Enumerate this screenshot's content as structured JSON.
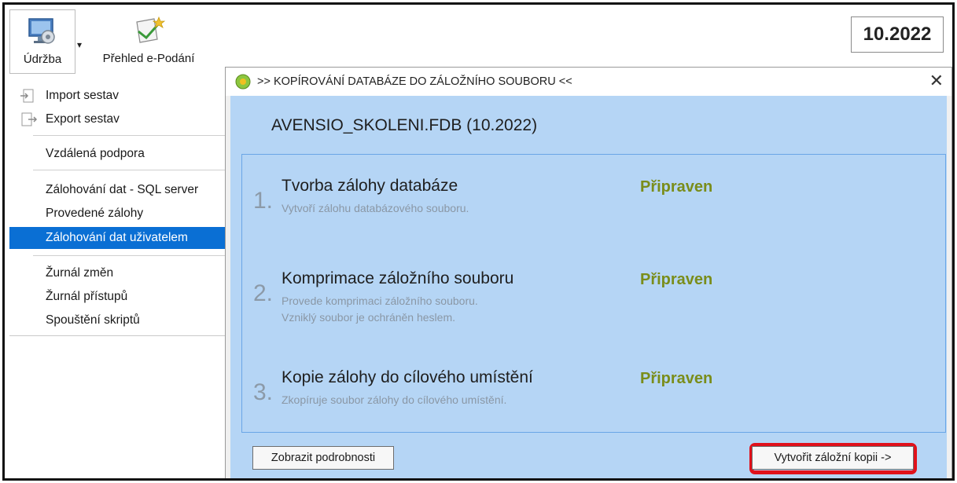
{
  "ribbon": {
    "udrzba_label": "Údržba",
    "prehled_label": "Přehled e-Podání",
    "period": "10.2022",
    "icons": [
      "computer-maintenance-icon",
      "e-submission-overview-icon"
    ]
  },
  "menu": {
    "import": "Import sestav",
    "export": "Export sestav",
    "remote": "Vzdálená podpora",
    "backup_sql": "Zálohování dat - SQL server",
    "done_backups": "Provedené zálohy",
    "user_backup": "Zálohování dat uživatelem",
    "change_log": "Žurnál změn",
    "access_log": "Žurnál přístupů",
    "scripts": "Spouštění skriptů",
    "selected_color": "#0a6fd4"
  },
  "dialog": {
    "title": ">> KOPÍROVÁNÍ DATABÁZE DO ZÁLOŽNÍHO SOUBORU <<",
    "close": "✕",
    "db_name": "AVENSIO_SKOLENI.FDB (10.2022)",
    "steps": [
      {
        "num": "1.",
        "title": "Tvorba zálohy databáze",
        "desc1": "Vytvoří zálohu databázového souboru.",
        "desc2": "",
        "status": "Připraven"
      },
      {
        "num": "2.",
        "title": "Komprimace záložního souboru",
        "desc1": "Provede komprimaci záložního souboru.",
        "desc2": "Vzniklý soubor je ochráněn heslem.",
        "status": "Připraven"
      },
      {
        "num": "3.",
        "title": "Kopie zálohy do cílového umístění",
        "desc1": "Zkopíruje soubor zálohy do cílového umístění.",
        "desc2": "",
        "status": "Připraven"
      }
    ],
    "details_button": "Zobrazit podrobnosti",
    "create_button": "Vytvořit záložní kopii ->",
    "status_color": "#7a8d1a",
    "panel_color": "#b5d5f5",
    "highlight_color": "#e0111b"
  }
}
